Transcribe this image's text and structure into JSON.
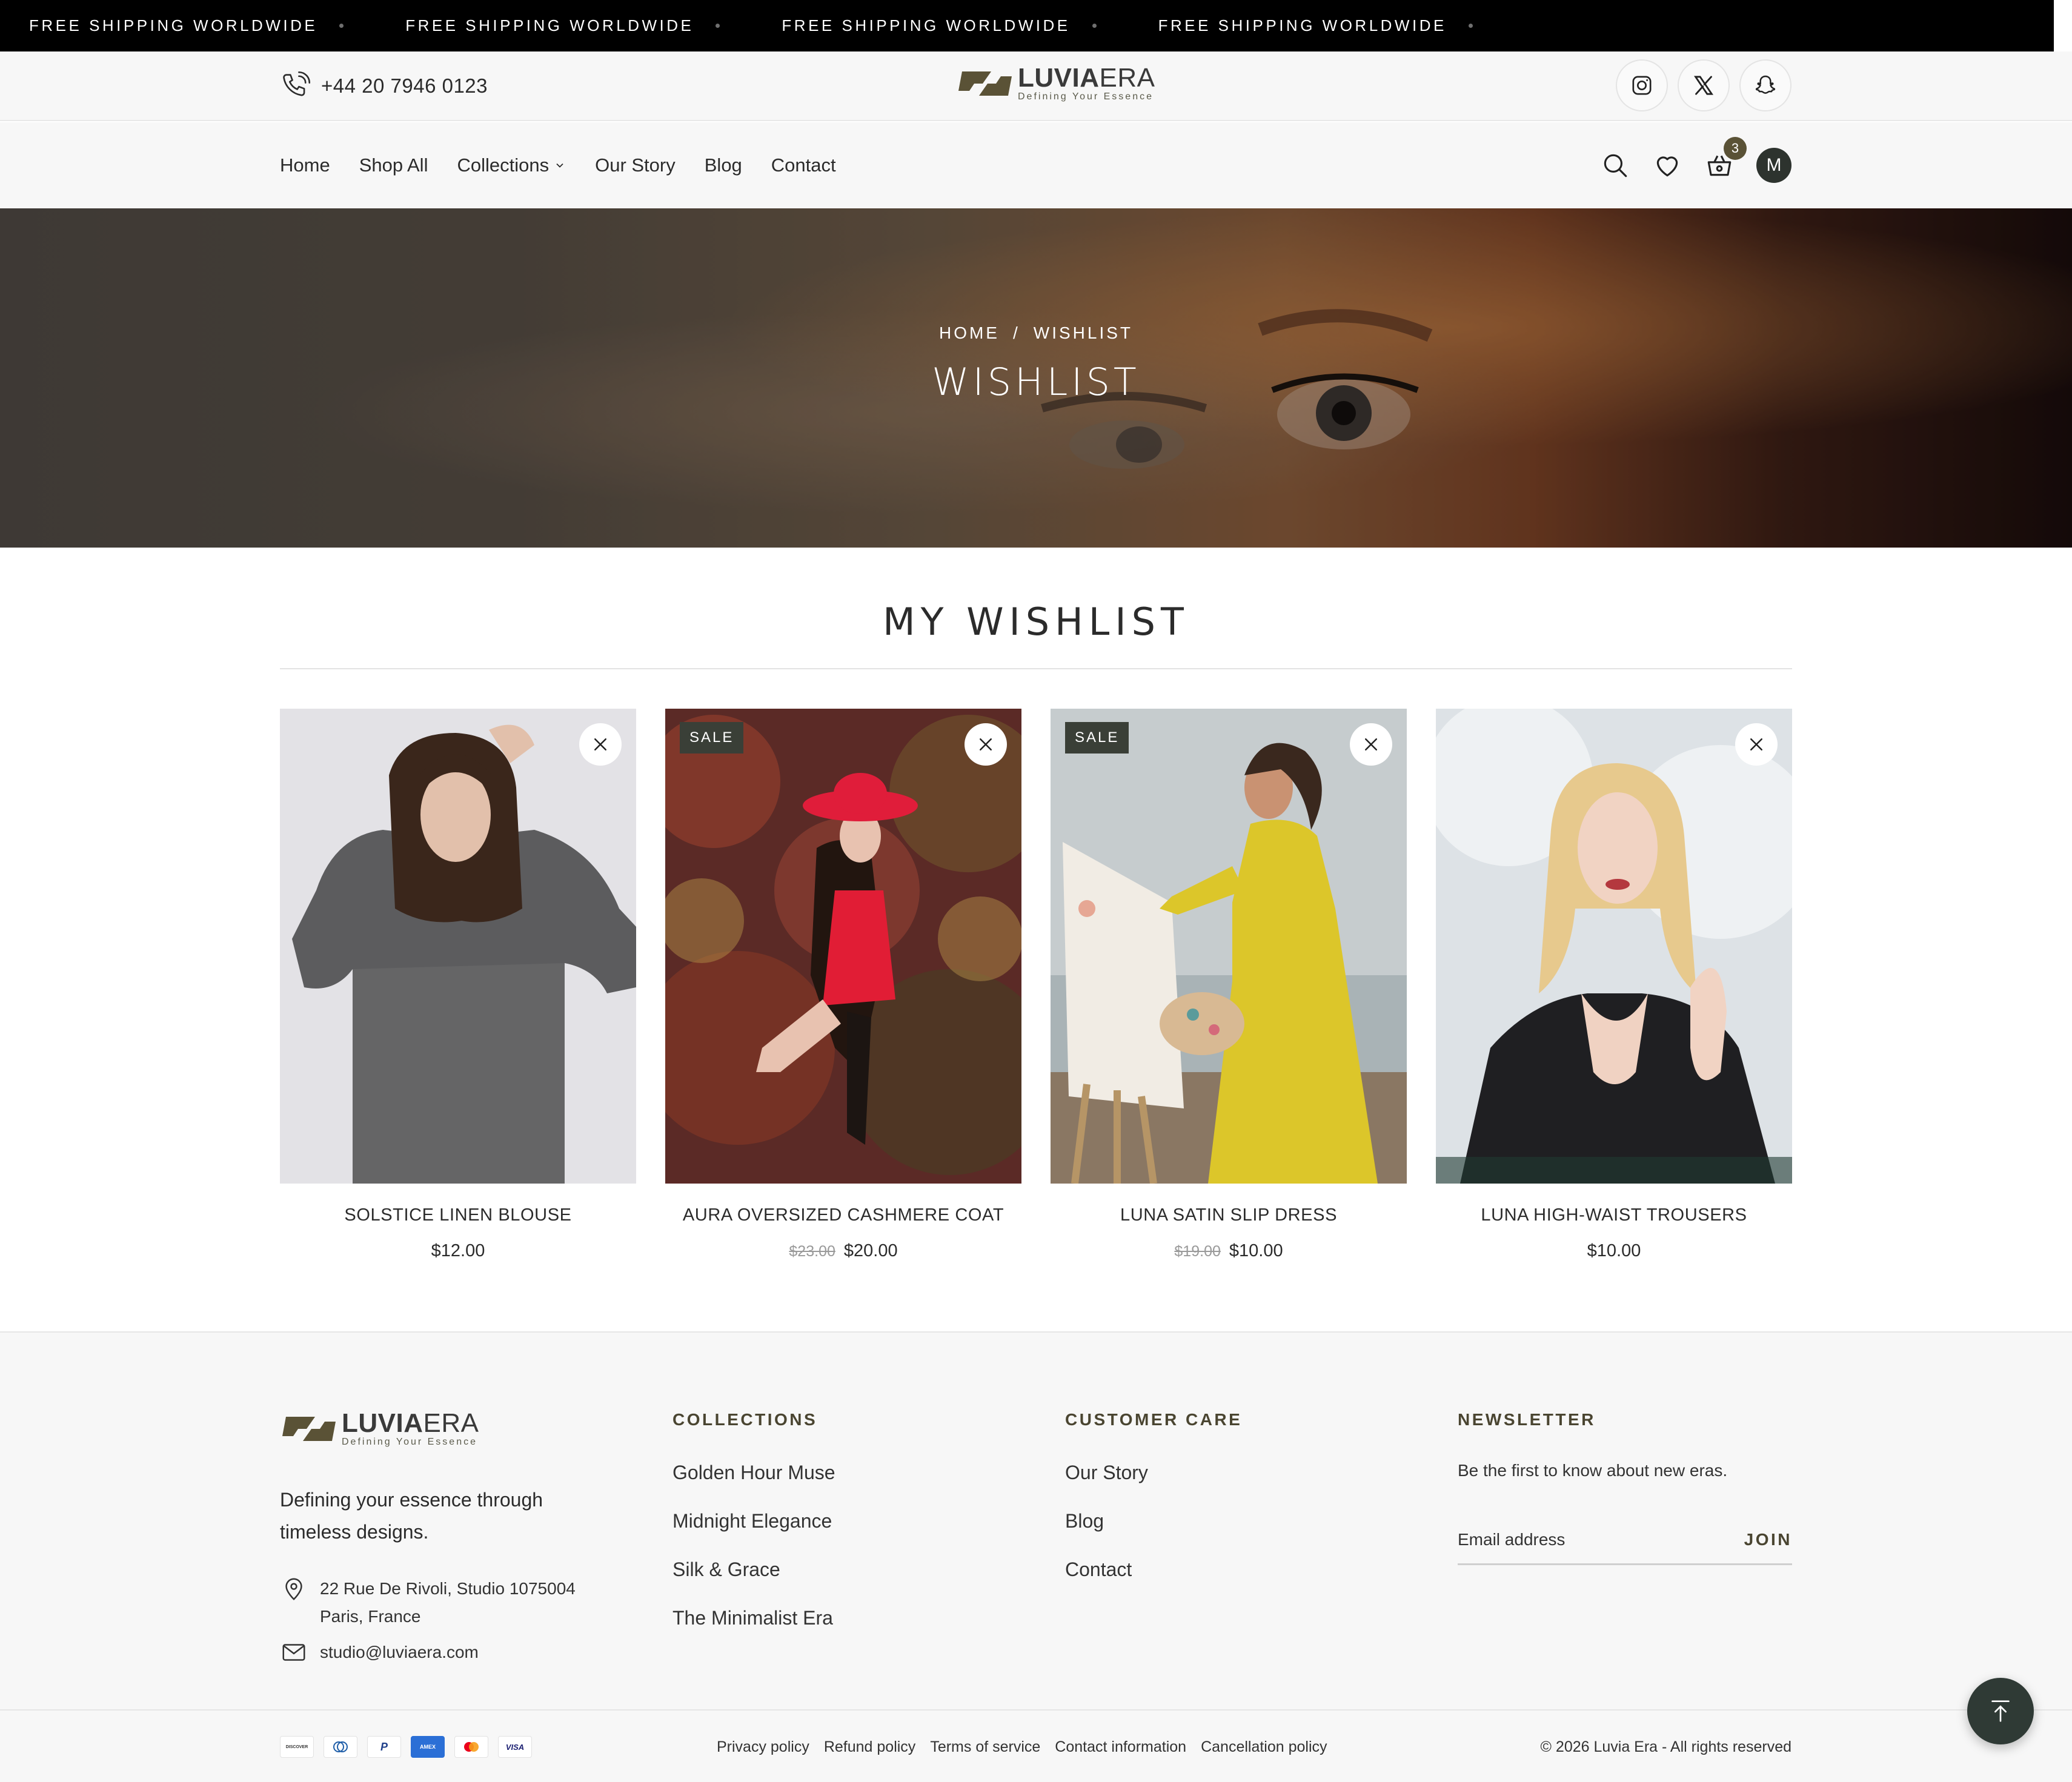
{
  "announcement": {
    "items": [
      "FREE SHIPPING WORLDWIDE",
      "FREE SHIPPING WORLDWIDE",
      "FREE SHIPPING WORLDWIDE",
      "FREE SHIPPING WORLDWIDE"
    ]
  },
  "header": {
    "phone": "+44 20 7946 0123",
    "logo": {
      "name_bold": "LUVIA",
      "name_light": "ERA",
      "tagline": "Defining Your Essence"
    },
    "socials": [
      "instagram-icon",
      "x-twitter-icon",
      "snapchat-icon"
    ]
  },
  "nav": {
    "links": [
      "Home",
      "Shop All",
      "Collections",
      "Our Story",
      "Blog",
      "Contact"
    ],
    "cart_count": "3",
    "avatar_initial": "M"
  },
  "hero": {
    "breadcrumb": [
      "HOME",
      "/",
      "WISHLIST"
    ],
    "title": "WISHLIST"
  },
  "wishlist": {
    "title": "MY WISHLIST",
    "products": [
      {
        "name": "SOLSTICE LINEN BLOUSE",
        "price": "$12.00",
        "old_price": "",
        "sale": false
      },
      {
        "name": "AURA OVERSIZED CASHMERE COAT",
        "price": "$20.00",
        "old_price": "$23.00",
        "sale": true,
        "sale_label": "SALE"
      },
      {
        "name": "LUNA SATIN SLIP DRESS",
        "price": "$10.00",
        "old_price": "$19.00",
        "sale": true,
        "sale_label": "SALE"
      },
      {
        "name": "LUNA HIGH-WAIST TROUSERS",
        "price": "$10.00",
        "old_price": "",
        "sale": false
      }
    ]
  },
  "footer": {
    "logo": {
      "name_bold": "LUVIA",
      "name_light": "ERA",
      "tagline": "Defining Your Essence"
    },
    "tagline": "Defining your essence through timeless designs.",
    "address": "22 Rue De Rivoli, Studio 1075004 Paris, France",
    "email": "studio@luviaera.com",
    "collections": {
      "title": "COLLECTIONS",
      "links": [
        "Golden Hour Muse",
        "Midnight Elegance",
        "Silk & Grace",
        "The Minimalist Era"
      ]
    },
    "care": {
      "title": "CUSTOMER CARE",
      "links": [
        "Our Story",
        "Blog",
        "Contact"
      ]
    },
    "newsletter": {
      "title": "NEWSLETTER",
      "description": "Be the first to know about new eras.",
      "placeholder": "Email address",
      "button": "JOIN"
    },
    "payments": [
      "DISCOVER",
      "Diners",
      "PayPal",
      "AMEX",
      "Mastercard",
      "VISA"
    ],
    "legal": [
      "Privacy policy",
      "Refund policy",
      "Terms of service",
      "Contact information",
      "Cancellation policy"
    ],
    "copyright": "© 2026 Luvia Era - All rights reserved"
  },
  "colors": {
    "accent": "#5a5236",
    "dark": "#2f3a35",
    "announcement_bg": "#000000"
  }
}
